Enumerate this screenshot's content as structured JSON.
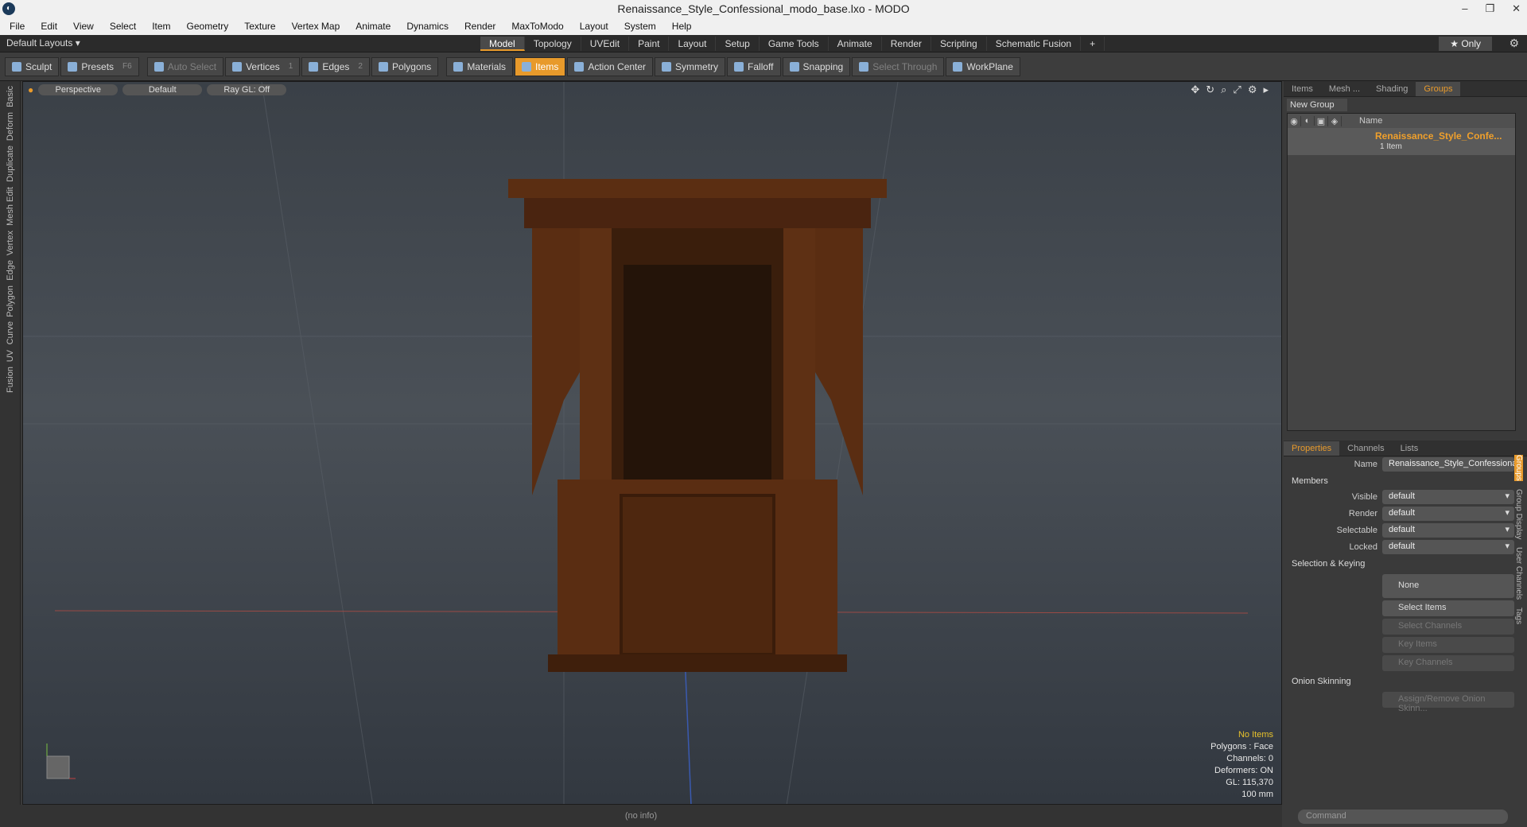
{
  "window": {
    "title": "Renaissance_Style_Confessional_modo_base.lxo - MODO"
  },
  "menu": [
    "File",
    "Edit",
    "View",
    "Select",
    "Item",
    "Geometry",
    "Texture",
    "Vertex Map",
    "Animate",
    "Dynamics",
    "Render",
    "MaxToModo",
    "Layout",
    "System",
    "Help"
  ],
  "layout": {
    "default_layouts": "Default Layouts ▾",
    "tabs": [
      "Model",
      "Topology",
      "UVEdit",
      "Paint",
      "Layout",
      "Setup",
      "Game Tools",
      "Animate",
      "Render",
      "Scripting",
      "Schematic Fusion"
    ],
    "active_tab": "Model",
    "add": "+",
    "only": "★  Only"
  },
  "toolbar": {
    "sculpt": "Sculpt",
    "presets": "Presets",
    "presets_key": "F6",
    "auto_select": "Auto Select",
    "vertices": "Vertices",
    "vertices_count": "1",
    "edges": "Edges",
    "edges_count": "2",
    "polygons": "Polygons",
    "materials": "Materials",
    "items": "Items",
    "action_center": "Action Center",
    "symmetry": "Symmetry",
    "falloff": "Falloff",
    "snapping": "Snapping",
    "select_through": "Select Through",
    "workplane": "WorkPlane"
  },
  "left_tabs": [
    "Basic",
    "Deform",
    "Duplicate",
    "Mesh Edit",
    "Vertex",
    "Edge",
    "Polygon",
    "Curve",
    "UV",
    "Fusion"
  ],
  "viewport": {
    "perspective": "Perspective",
    "default": "Default",
    "raygl": "Ray GL: Off",
    "stats": {
      "no_items": "No Items",
      "polygons": "Polygons : Face",
      "channels": "Channels: 0",
      "deformers": "Deformers: ON",
      "gl": "GL: 115,370",
      "scale": "100 mm"
    }
  },
  "status": "(no info)",
  "groups_panel": {
    "tabs": [
      "Items",
      "Mesh ...",
      "Shading",
      "Groups"
    ],
    "active_tab": "Groups",
    "new_group": "New Group",
    "col_name": "Name",
    "item_name": "Renaissance_Style_Confe...",
    "item_count": "1 Item"
  },
  "properties": {
    "tabs": [
      "Properties",
      "Channels",
      "Lists"
    ],
    "active_tab": "Properties",
    "name_label": "Name",
    "name_value": "Renaissance_Style_Confessional",
    "members": "Members",
    "visible_label": "Visible",
    "render_label": "Render",
    "selectable_label": "Selectable",
    "locked_label": "Locked",
    "default": "default",
    "selection_keying": "Selection & Keying",
    "none": "None",
    "select_items": "Select Items",
    "select_channels": "Select Channels",
    "key_items": "Key Items",
    "key_channels": "Key Channels",
    "onion": "Onion Skinning",
    "assign_onion": "Assign/Remove Onion Skinn...",
    "side_tabs": [
      "Groups",
      "Group Display",
      "User Channels",
      "Tags"
    ],
    "command": "Command"
  }
}
